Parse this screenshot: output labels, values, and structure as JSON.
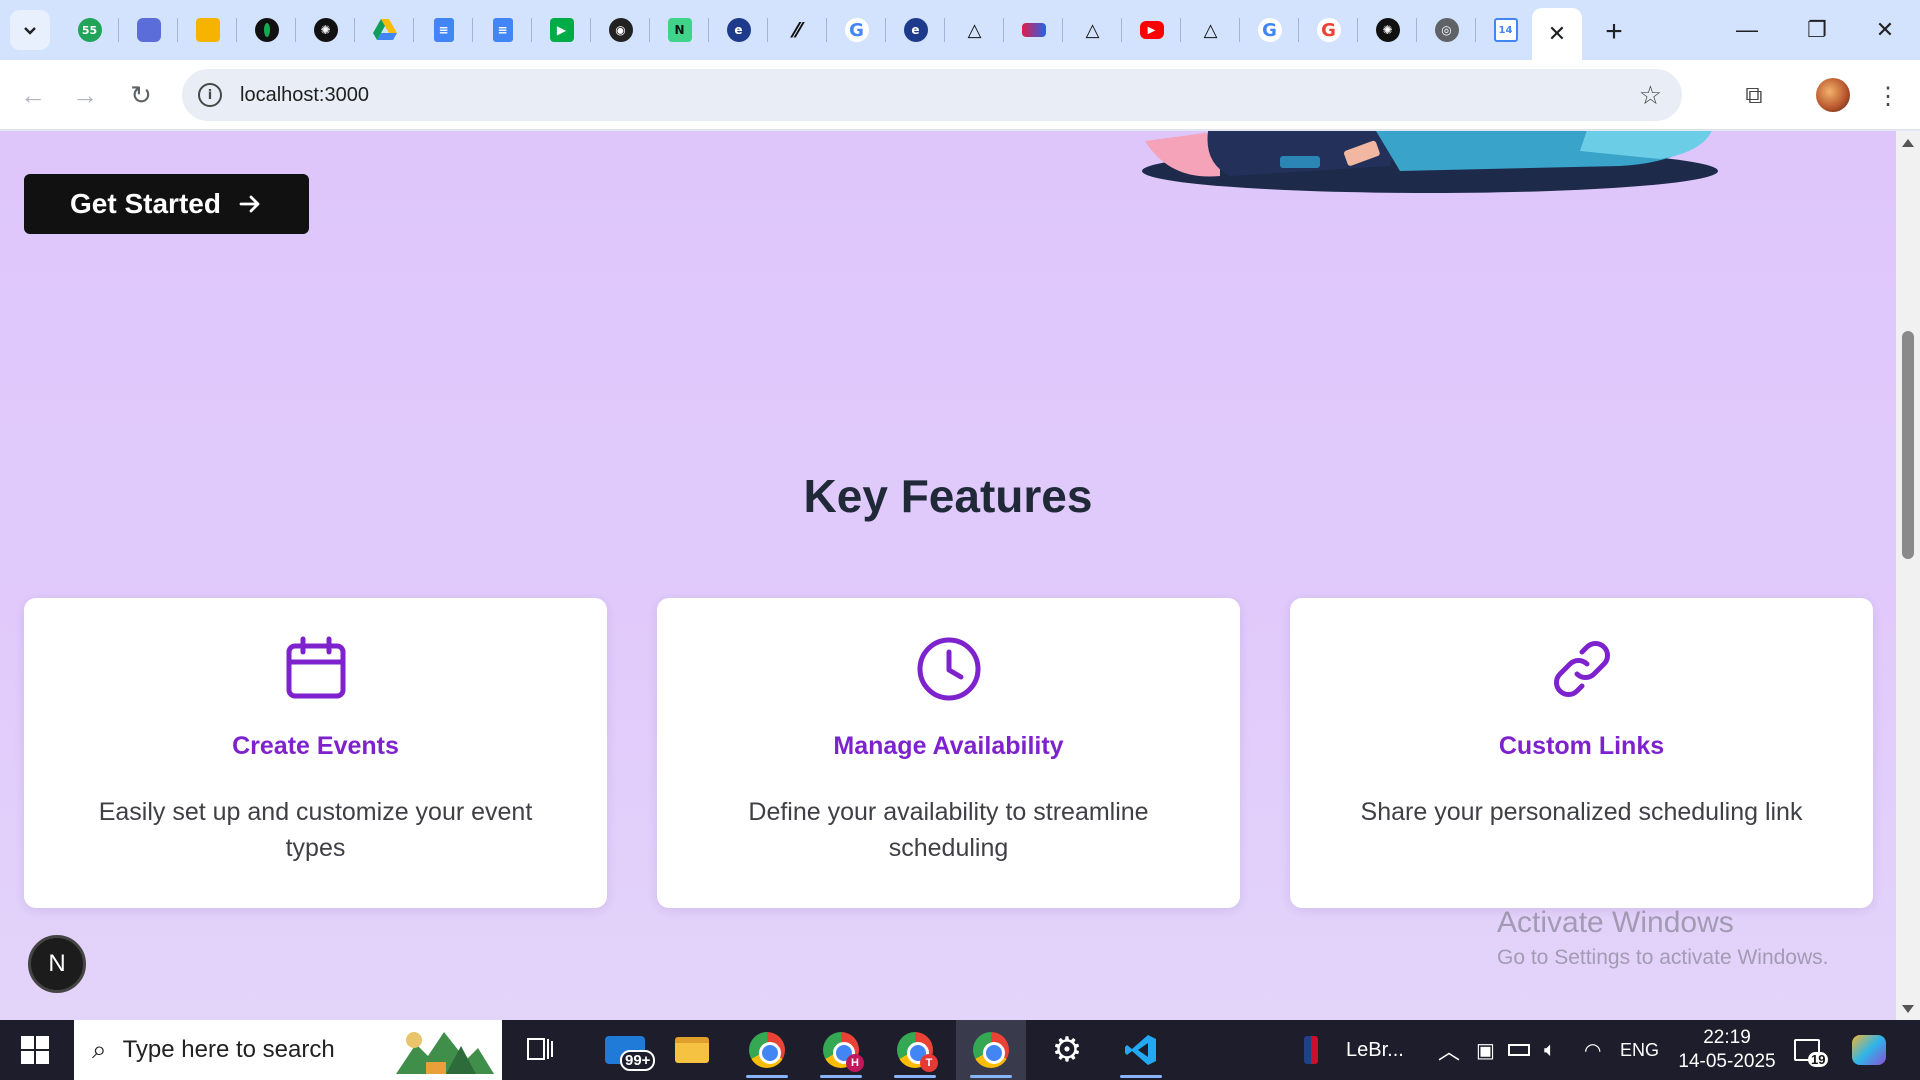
{
  "browser": {
    "url": "localhost:3000",
    "tab_icons": [
      "counter-55-icon",
      "copilot-icon",
      "slides-icon",
      "mongodb-icon",
      "openai-icon",
      "drive-icon",
      "docs-icon",
      "docs-icon",
      "meet-icon",
      "github-icon",
      "notion-icon",
      "edge-icon",
      "pen-icon",
      "google-icon",
      "edge-icon",
      "vercel-icon",
      "flow-icon",
      "vercel-icon",
      "youtube-icon",
      "vercel-icon",
      "google-icon",
      "google-icon",
      "openai-icon",
      "chrome-icon",
      "calendar-icon"
    ],
    "counter_badge": "55",
    "calendar_badge": "14"
  },
  "page": {
    "cta_label": "Get Started",
    "section_title": "Key Features",
    "features": [
      {
        "icon": "calendar-icon",
        "title": "Create Events",
        "description": "Easily set up and customize your event types"
      },
      {
        "icon": "clock-icon",
        "title": "Manage Availability",
        "description": "Define your availability to streamline scheduling"
      },
      {
        "icon": "link-icon",
        "title": "Custom Links",
        "description": "Share your personalized scheduling link"
      }
    ],
    "dev_badge": "N",
    "accent": "#7e22ce"
  },
  "watermark": {
    "line1": "Activate Windows",
    "line2": "Go to Settings to activate Windows."
  },
  "taskbar": {
    "search_placeholder": "Type here to search",
    "mail_badge": "99+",
    "chrome_h_badge": "H",
    "chrome_t_badge": "T",
    "news_label": "LeBr...",
    "language": "ENG",
    "time": "22:19",
    "date": "14-05-2025",
    "notification_count": "19"
  }
}
